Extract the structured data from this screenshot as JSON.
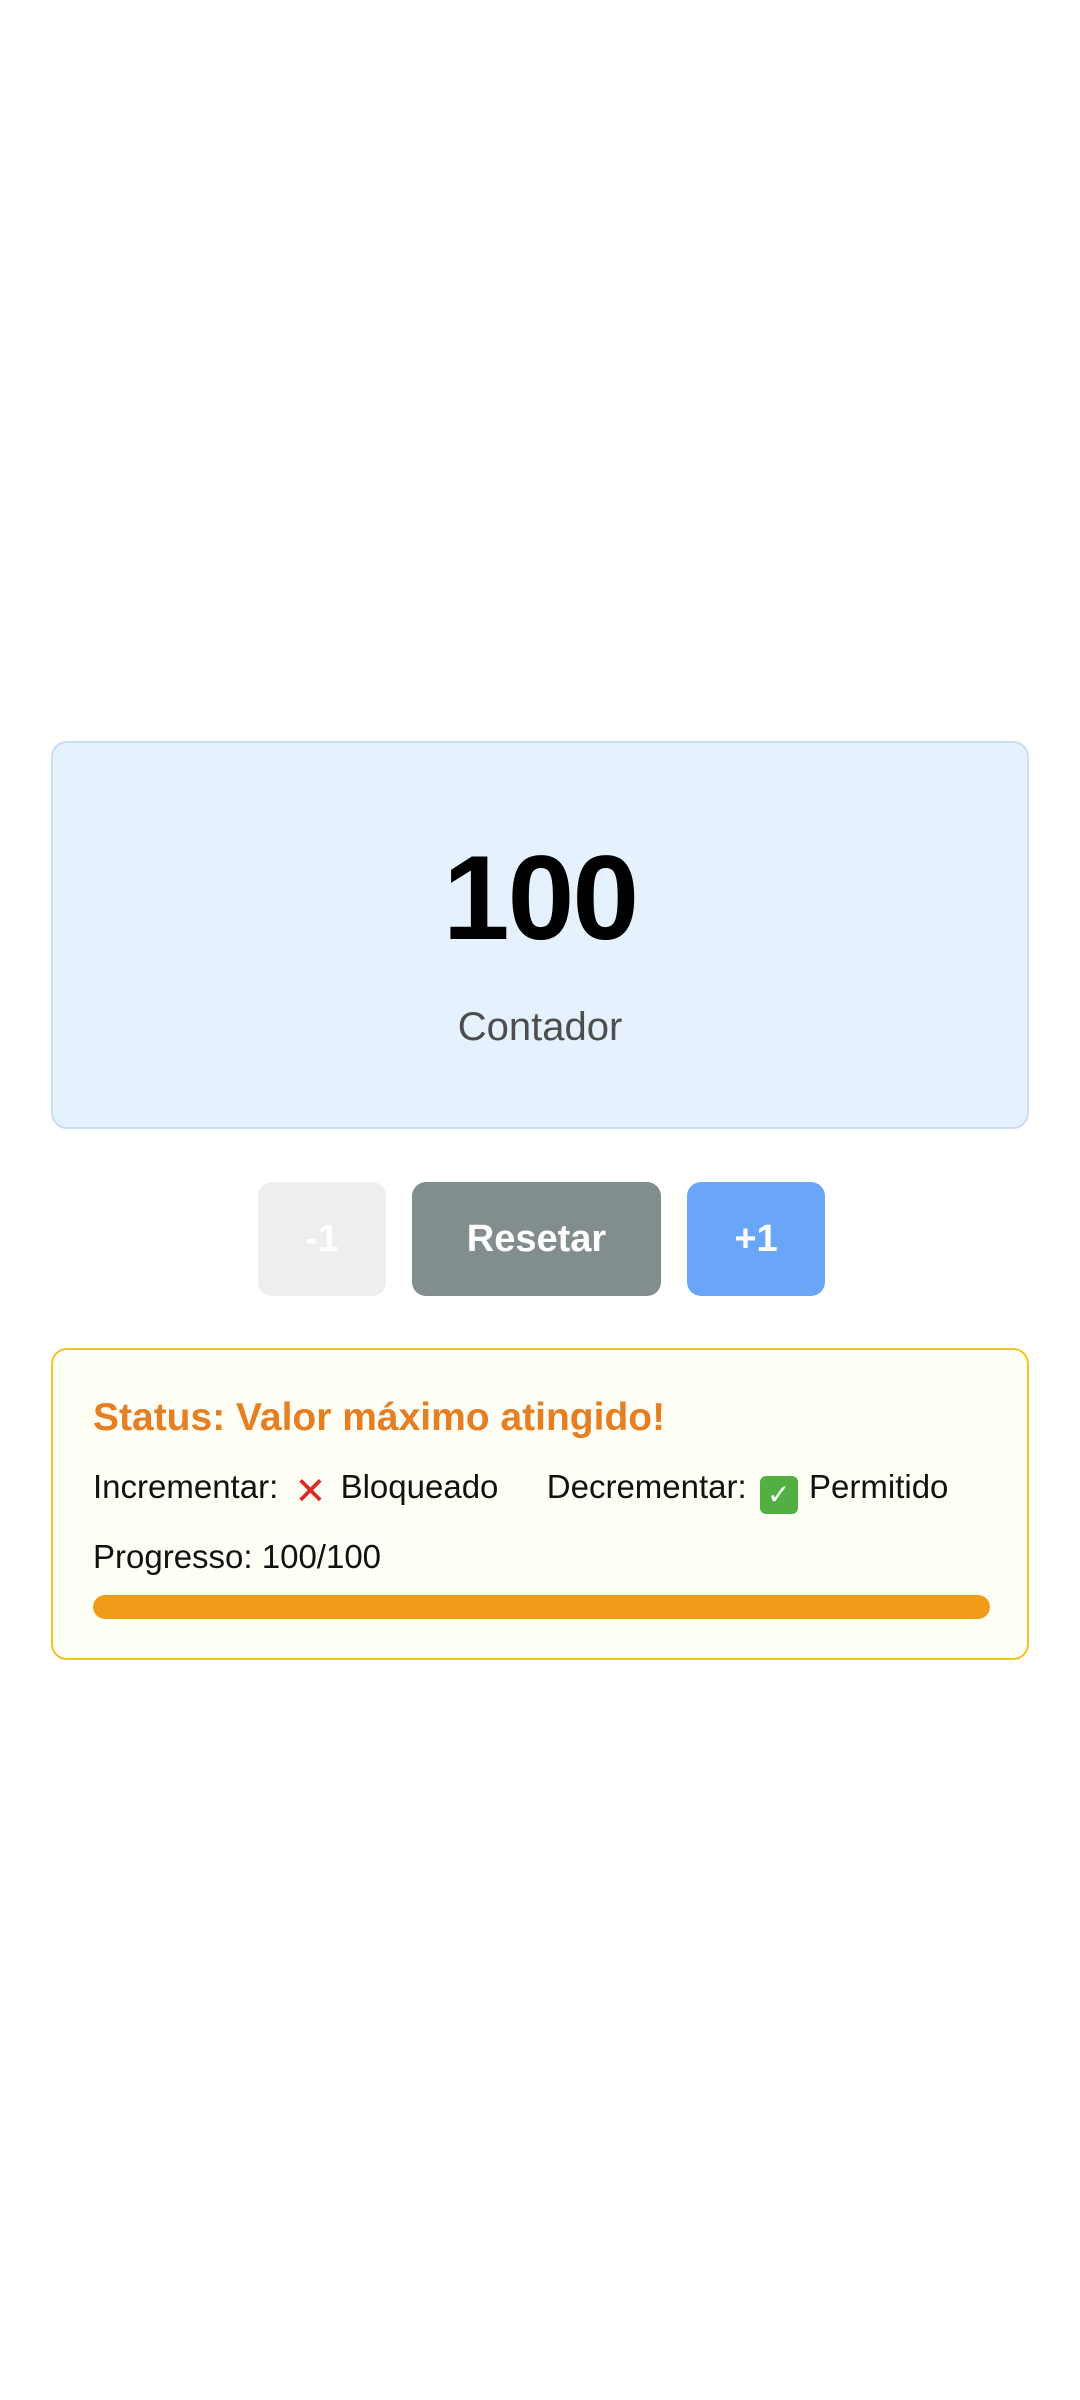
{
  "counter": {
    "value": "100",
    "label": "Contador"
  },
  "buttons": {
    "decrement_label": "-1",
    "reset_label": "Resetar",
    "increment_label": "+1"
  },
  "status": {
    "title": "Status: Valor máximo atingido!",
    "increment_label": "Incrementar:",
    "increment_state": "Bloqueado",
    "increment_icon": "cross-mark-icon",
    "decrement_label": "Decrementar:",
    "decrement_state": "Permitido",
    "decrement_icon": "check-mark-icon",
    "progress_text": "Progresso: 100/100",
    "progress_fraction": 1.0
  },
  "colors": {
    "card_background": "#e5f1fd",
    "reset_button": "#828d8e",
    "increment_button": "#6aa6f8",
    "decrement_button_disabled": "#eeeeee",
    "status_title": "#e67e22",
    "status_border": "#f1c520",
    "progress_fill": "#f09c1a"
  }
}
